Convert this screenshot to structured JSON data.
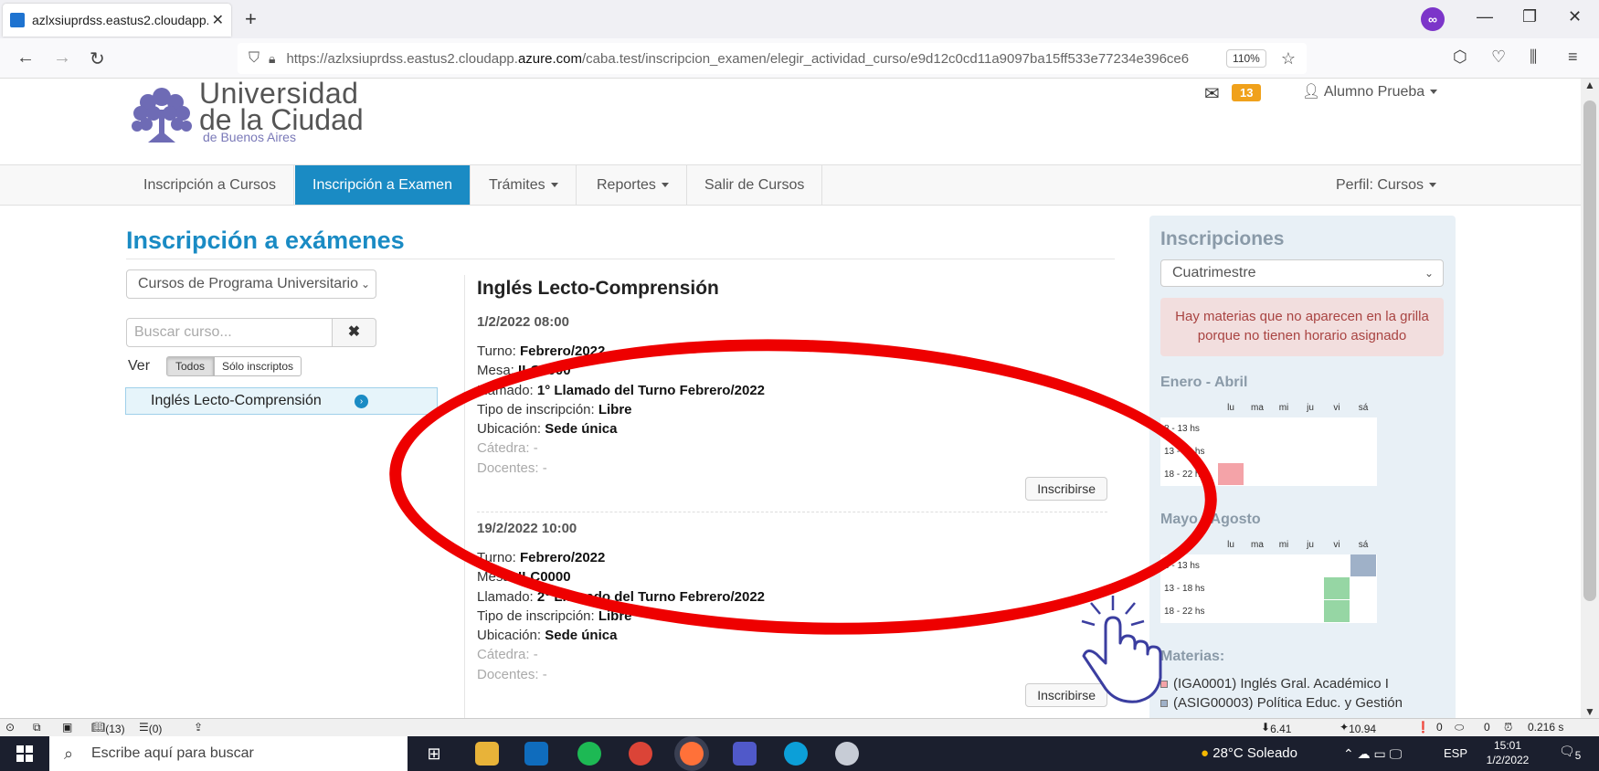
{
  "browser": {
    "tab_title": "azlxsiuprdss.eastus2.cloudapp.a",
    "tab_close": "✕",
    "new_tab": "+",
    "url_prefix": "https://azlxsiuprdss.eastus2.cloudapp.",
    "url_domain": "azure.com",
    "url_path": "/caba.test/inscripcion_examen/elegir_actividad_curso/e9d12c0cd11a9097ba15ff533e77234e396ce6",
    "zoom": "110%"
  },
  "header": {
    "logo_line1": "Universidad",
    "logo_line2": "de la Ciudad",
    "logo_line3": "de Buenos Aires",
    "mail_count": "13",
    "user_name": "Alumno Prueba"
  },
  "nav": {
    "items": [
      {
        "label": "Inscripción a Cursos"
      },
      {
        "label": "Inscripción a Examen"
      },
      {
        "label": "Trámites"
      },
      {
        "label": "Reportes"
      },
      {
        "label": "Salir de Cursos"
      }
    ],
    "perfil": "Perfil: Cursos"
  },
  "main": {
    "title": "Inscripción a exámenes",
    "program_select": "Cursos de Programa Universitario",
    "search_placeholder": "Buscar curso...",
    "ver_label": "Ver",
    "filter_all": "Todos",
    "filter_enrolled": "Sólo inscriptos",
    "course_item": "Inglés Lecto-Comprensión",
    "course_title": "Inglés Lecto-Comprensión",
    "exams": [
      {
        "date": "1/2/2022 08:00",
        "turno_label": "Turno:",
        "turno": "Febrero/2022",
        "mesa_label": "Mesa:",
        "mesa": "ILC0000",
        "llamado_label": "Llamado:",
        "llamado": "1° Llamado del Turno Febrero/2022",
        "tipo_label": "Tipo de inscripción:",
        "tipo": "Libre",
        "ubicacion_label": "Ubicación:",
        "ubicacion": "Sede única",
        "catedra": "Cátedra: -",
        "docentes": "Docentes: -",
        "button": "Inscribirse"
      },
      {
        "date": "19/2/2022 10:00",
        "turno_label": "Turno:",
        "turno": "Febrero/2022",
        "mesa_label": "Mesa:",
        "mesa": "ILC0000",
        "llamado_label": "Llamado:",
        "llamado": "2° Llamado del Turno Febrero/2022",
        "tipo_label": "Tipo de inscripción:",
        "tipo": "Libre",
        "ubicacion_label": "Ubicación:",
        "ubicacion": "Sede única",
        "catedra": "Cátedra: -",
        "docentes": "Docentes: -",
        "button": "Inscribirse"
      }
    ]
  },
  "sidebar": {
    "title": "Inscripciones",
    "period_select": "Cuatrimestre",
    "alert": "Hay materias que no aparecen en la grilla porque no tienen horario asignado",
    "days": [
      "lu",
      "ma",
      "mi",
      "ju",
      "vi",
      "sá"
    ],
    "rows": [
      "8 - 13 hs",
      "13 - 18 hs",
      "18 - 22 hs"
    ],
    "section1": "Enero - Abril",
    "section2": "Mayo - Agosto",
    "materias_label": "Materias:",
    "materias": [
      "(IGA0001) Inglés Gral. Académico I",
      "(ASIG00003) Política Educ. y Gestión"
    ],
    "colors": {
      "pink": "#f4a3a8",
      "blue": "#9fb1c8",
      "green": "#96d6a4"
    }
  },
  "statusbar": {
    "count1": "(13)",
    "count2": "(0)",
    "kb": "6.41 Kb",
    "mb": "10.94 Mb",
    "err": "0",
    "warn": "0",
    "time": "0.216 s"
  },
  "taskbar": {
    "search_text": "Escribe aquí para buscar",
    "weather": "28°C Soleado",
    "lang": "ESP",
    "clock_time": "15:01",
    "clock_date": "1/2/2022",
    "notif": "5"
  },
  "accent": "#1a8bc4",
  "annotation_color": "#ee0000"
}
